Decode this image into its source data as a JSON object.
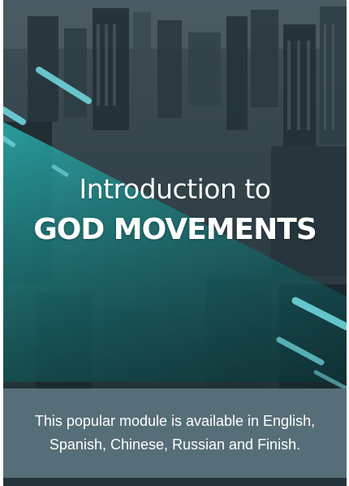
{
  "promo": {
    "title_line1": "Introduction to",
    "title_line2": "GOD MOVEMENTS",
    "caption": "This popular module is available in English, Spanish, Chinese, Russian and Finish.",
    "background_image": "city-skyline-aerial",
    "colors": {
      "overlay_teal": "#2fa3a6",
      "accent_cyan": "#6fd4dc",
      "caption_bg": "#566e78",
      "text": "#ffffff"
    }
  }
}
